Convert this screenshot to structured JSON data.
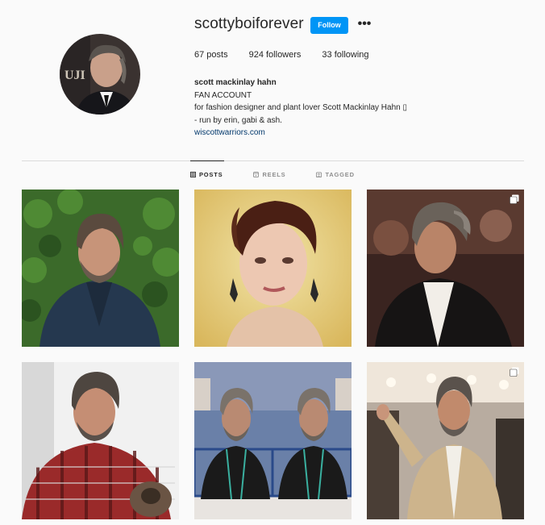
{
  "profile": {
    "username": "scottyboiforever",
    "follow_label": "Follow",
    "more_icon": "more-horizontal-icon",
    "stats": {
      "posts": "67 posts",
      "followers": "924 followers",
      "following": "33 following"
    },
    "bio": {
      "name": "scott mackinlay hahn",
      "line1": "FAN ACCOUNT",
      "line2": "for fashion designer and plant lover Scott Mackinlay Hahn ▯",
      "line3": "- run by erin, gabi & ash.",
      "link": "wiscottwarriors.com"
    }
  },
  "tabs": [
    {
      "label": "POSTS",
      "icon": "grid-icon",
      "active": true
    },
    {
      "label": "REELS",
      "icon": "reels-icon",
      "active": false
    },
    {
      "label": "TAGGED",
      "icon": "tagged-icon",
      "active": false
    }
  ],
  "colors": {
    "accent": "#0095f6",
    "link": "#00376b",
    "divider": "#dbdbdb"
  }
}
